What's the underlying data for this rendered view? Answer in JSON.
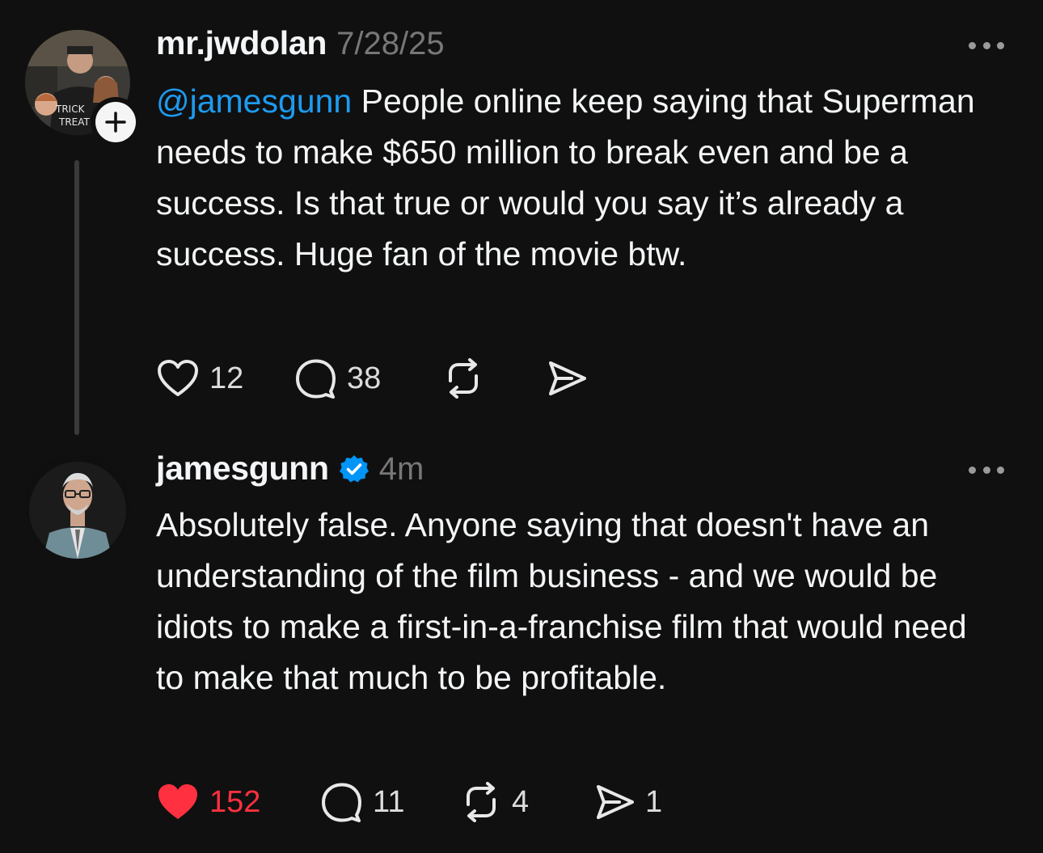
{
  "posts": [
    {
      "username": "mr.jwdolan",
      "timestamp": "7/28/25",
      "mention": "@jamesgunn",
      "text": " People online keep saying that Superman needs to make $650 million to break even and be a success. Is that true or would you say it’s already a success. Huge fan of the movie btw.",
      "likes": "12",
      "replies": "38",
      "reposts": "",
      "shares": "",
      "liked": false
    },
    {
      "username": "jamesgunn",
      "verified": true,
      "timestamp": "4m",
      "text": "Absolutely false. Anyone saying that doesn't have an understanding of the film business - and we would be idiots to make a first-in-a-franchise film that would need to make that much to be profitable.",
      "likes": "152",
      "replies": "11",
      "reposts": "4",
      "shares": "1",
      "liked": true
    }
  ],
  "colors": {
    "background": "#101010",
    "text": "#f3f5f7",
    "muted": "#777777",
    "mention": "#1d9bf0",
    "like": "#ff3040",
    "verified": "#0095f6"
  },
  "icons": [
    "heart-icon",
    "reply-icon",
    "repost-icon",
    "share-icon",
    "more-icon",
    "verified-icon",
    "plus-icon"
  ]
}
